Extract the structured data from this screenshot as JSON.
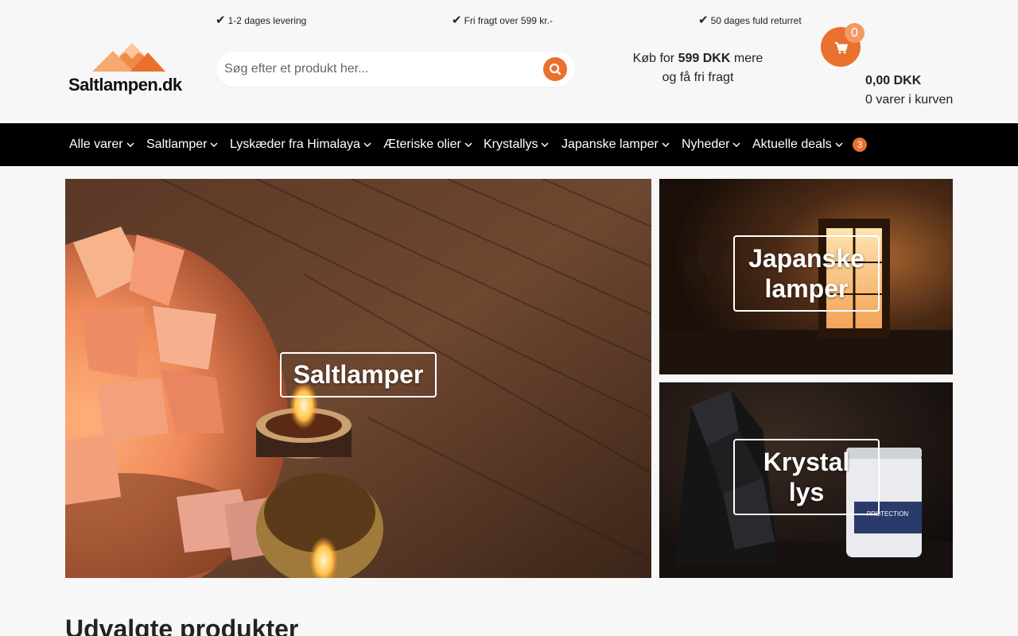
{
  "usp": {
    "delivery": "1-2 dages levering",
    "freight": "Fri fragt over 599 kr.-",
    "returns": "50 dages fuld returret"
  },
  "logo": {
    "text": "Saltlampen.dk"
  },
  "search": {
    "placeholder": "Søg efter et produkt her..."
  },
  "freeship": {
    "prefix": "Køb for",
    "amount": "599 DKK",
    "suffix": "mere",
    "line2": "og få fri fragt"
  },
  "cart": {
    "badge": "0",
    "total": "0,00 DKK",
    "count_text": "0 varer i kurven"
  },
  "nav": {
    "items": [
      {
        "label": "Alle varer"
      },
      {
        "label": "Saltlamper"
      },
      {
        "label": "Lyskæder fra Himalaya"
      },
      {
        "label": "Æteriske olier"
      },
      {
        "label": "Krystallys"
      },
      {
        "label": "Japanske lamper"
      },
      {
        "label": "Nyheder"
      },
      {
        "label": "Aktuelle deals"
      }
    ],
    "deals_badge": "3"
  },
  "banners": {
    "main": {
      "label": "Saltlamper"
    },
    "japanese": {
      "line1": "Japanske",
      "line2": "lamper"
    },
    "crystal": {
      "line1": "Krystal",
      "line2": "lys",
      "candle_label": "PROTECTION"
    }
  },
  "section": {
    "title": "Udvalgte produkter"
  },
  "colors": {
    "accent": "#e9712d",
    "nav_bg": "#000000",
    "page_bg": "#f7f7f7"
  },
  "icons": {
    "check": "check-icon",
    "search": "search-icon",
    "cart": "cart-icon",
    "chevron": "chevron-down-icon"
  }
}
